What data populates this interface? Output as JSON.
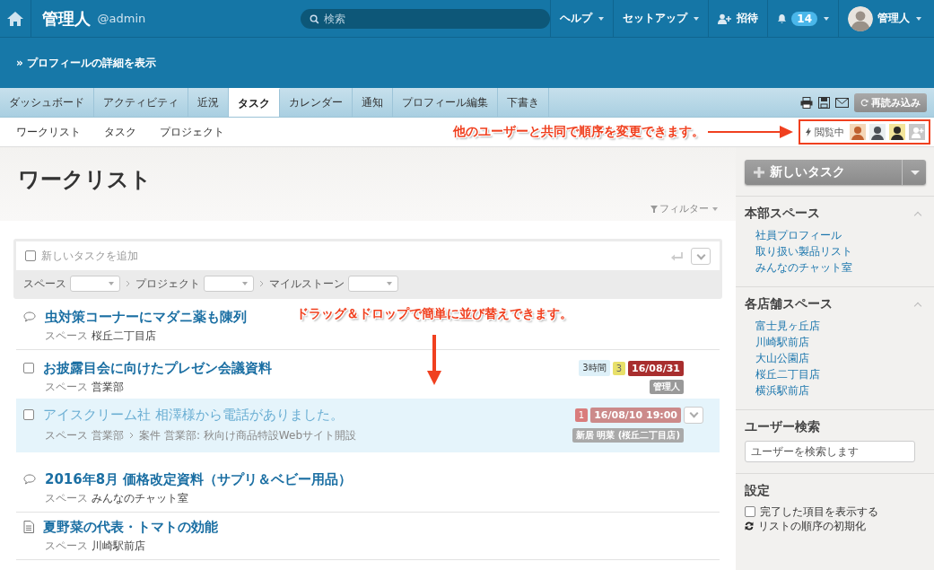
{
  "top_bar": {
    "title": "管理人",
    "handle": "@admin",
    "search": {
      "placeholder": "検索"
    },
    "menus": [
      {
        "kind": "dropdown",
        "label": "ヘルプ"
      },
      {
        "kind": "dropdown",
        "label": "セットアップ"
      },
      {
        "kind": "invite",
        "label": "招待"
      },
      {
        "kind": "notifications",
        "label": "14"
      },
      {
        "kind": "user",
        "label": "管理人"
      }
    ]
  },
  "profile_link": "» プロフィールの詳細を表示",
  "tabs": [
    {
      "label": "ダッシュボード",
      "selected": false
    },
    {
      "label": "アクティビティ",
      "selected": false
    },
    {
      "label": "近況",
      "selected": false
    },
    {
      "label": "タスク",
      "selected": true
    },
    {
      "label": "カレンダー",
      "selected": false
    },
    {
      "label": "通知",
      "selected": false
    },
    {
      "label": "プロフィール編集",
      "selected": false
    },
    {
      "label": "下書き",
      "selected": false
    }
  ],
  "reload_button": "再読み込み",
  "subnav": [
    "ワークリスト",
    "タスク",
    "プロジェクト"
  ],
  "viewing": {
    "label": "閲覧中"
  },
  "page_title": "ワークリスト",
  "filter": "フィルター",
  "new_task": {
    "checked": false,
    "placeholder": "新しいタスクを追加",
    "selectors": [
      "スペース",
      "プロジェクト",
      "マイルストーン"
    ]
  },
  "items": [
    {
      "kind": "comment",
      "title": "虫対策コーナーにマダニ薬も陳列",
      "meta": [
        {
          "label": "スペース",
          "value": "桜丘二丁目店"
        }
      ]
    },
    {
      "kind": "task",
      "checked": false,
      "title": "お披露目会に向けたプレゼン会議資料",
      "meta": [
        {
          "label": "スペース",
          "value": "営業部"
        }
      ],
      "badges": [
        {
          "kind": "estimate",
          "text": "3時間"
        },
        {
          "kind": "priority",
          "text": "3"
        },
        {
          "kind": "due",
          "text": "16/08/31"
        }
      ],
      "assignee": "管理人",
      "dragged": {
        "checked": false,
        "title": "アイスクリーム社 相澤様から電話がありました。",
        "meta": [
          {
            "label": "スペース",
            "value": "営業部"
          },
          {
            "label": "案件",
            "value": "営業部: 秋向け商品特設Webサイト開設"
          }
        ],
        "badges": [
          {
            "kind": "priority",
            "text": "1"
          },
          {
            "kind": "due",
            "text": "16/08/10 19:00"
          }
        ],
        "assignee": "新居 明菜 (桜丘二丁目店)"
      }
    },
    {
      "kind": "comment",
      "title": "2016年8月 価格改定資料（サプリ＆ベビー用品）",
      "meta": [
        {
          "label": "スペース",
          "value": "みんなのチャット室"
        }
      ]
    },
    {
      "kind": "document",
      "title": "夏野菜の代表・トマトの効能",
      "meta": [
        {
          "label": "スペース",
          "value": "川崎駅前店"
        }
      ]
    }
  ],
  "sidebar": {
    "new_task_button": "新しいタスク",
    "sections": [
      {
        "title": "本部スペース",
        "expanded": true,
        "links": [
          "社員プロフィール",
          "取り扱い製品リスト",
          "みんなのチャット室"
        ]
      },
      {
        "title": "各店舗スペース",
        "expanded": true,
        "links": [
          "富士見ヶ丘店",
          "川崎駅前店",
          "大山公園店",
          "桜丘二丁目店",
          "横浜駅前店"
        ]
      }
    ],
    "user_search": {
      "title": "ユーザー検索",
      "placeholder": "ユーザーを検索します"
    },
    "settings": {
      "title": "設定",
      "show_completed": {
        "label": "完了した項目を表示する",
        "checked": false
      },
      "reset": "リストの順序の初期化"
    }
  },
  "annotations": [
    {
      "kind": "right",
      "text": "他のユーザーと共同で順序を変更できます。"
    },
    {
      "kind": "down",
      "text": "ドラッグ＆ドロップで簡単に並び替えできます。"
    }
  ]
}
